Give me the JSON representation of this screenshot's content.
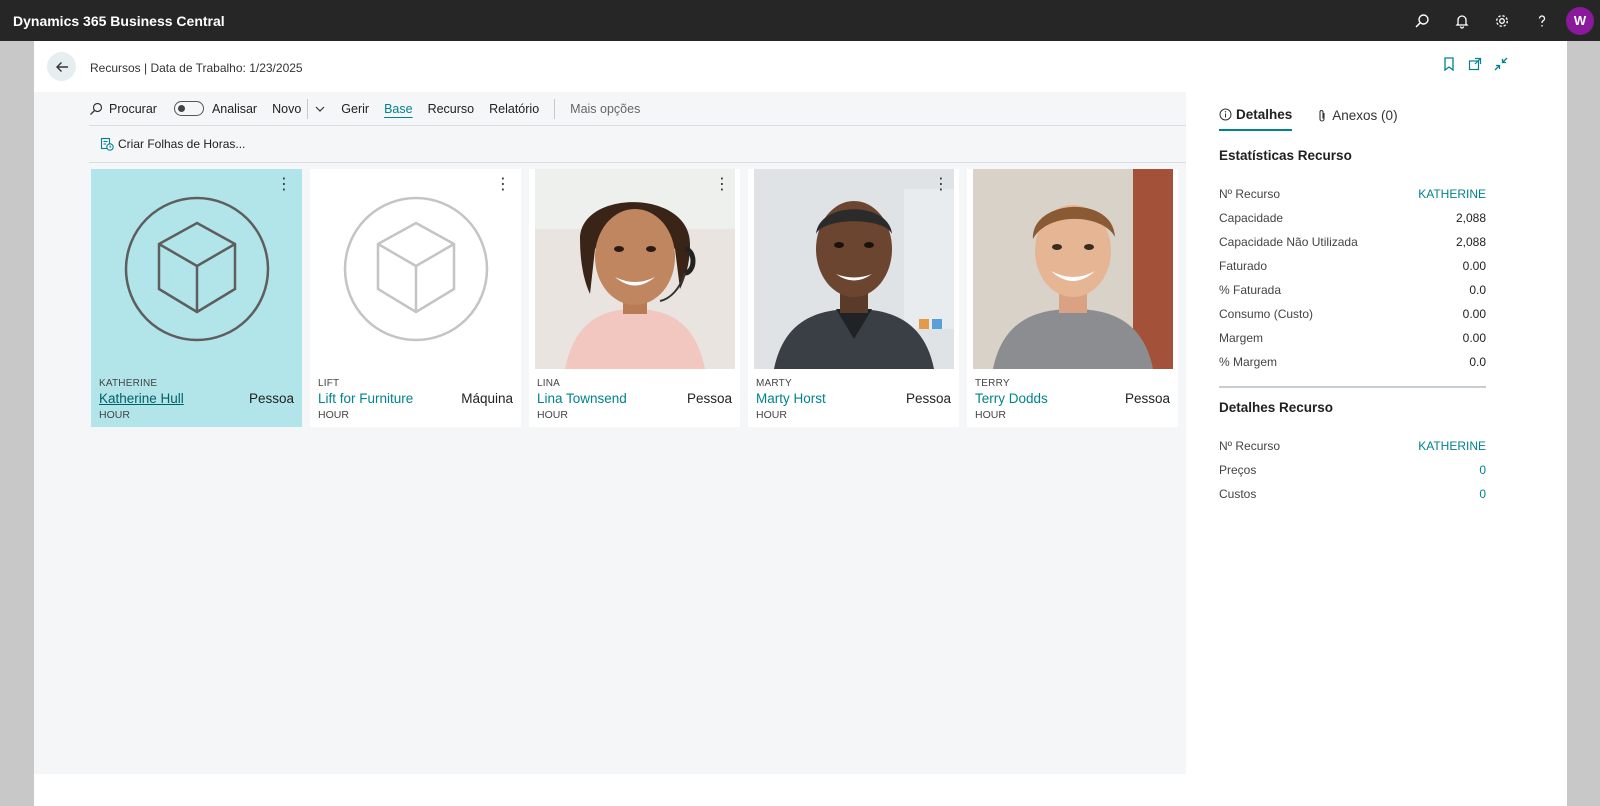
{
  "topbar": {
    "app_title": "Dynamics 365 Business Central",
    "avatar_initial": "W"
  },
  "page": {
    "breadcrumb": "Recursos | Data de Trabalho: 1/23/2025"
  },
  "actions": {
    "search": "Procurar",
    "analyze": "Analisar",
    "new": "Novo",
    "manage": "Gerir",
    "base": "Base",
    "resource": "Recurso",
    "report": "Relatório",
    "more": "Mais opções"
  },
  "promoted": {
    "create_timesheets": "Criar Folhas de Horas..."
  },
  "tiles": [
    {
      "code": "KATHERINE",
      "name": "Katherine Hull",
      "type": "Pessoa",
      "uom": "HOUR"
    },
    {
      "code": "LIFT",
      "name": "Lift for Furniture",
      "type": "Máquina",
      "uom": "HOUR"
    },
    {
      "code": "LINA",
      "name": "Lina Townsend",
      "type": "Pessoa",
      "uom": "HOUR"
    },
    {
      "code": "MARTY",
      "name": "Marty Horst",
      "type": "Pessoa",
      "uom": "HOUR"
    },
    {
      "code": "TERRY",
      "name": "Terry Dodds",
      "type": "Pessoa",
      "uom": "HOUR"
    }
  ],
  "factbox": {
    "tab_details": "Detalhes",
    "tab_attachments": "Anexos (0)",
    "stats_title": "Estatísticas Recurso",
    "stats": [
      {
        "label": "Nº Recurso",
        "value": "KATHERINE"
      },
      {
        "label": "Capacidade",
        "value": "2,088"
      },
      {
        "label": "Capacidade Não Utilizada",
        "value": "2,088"
      },
      {
        "label": "Faturado",
        "value": "0.00"
      },
      {
        "label": "% Faturada",
        "value": "0.0"
      },
      {
        "label": "Consumo (Custo)",
        "value": "0.00"
      },
      {
        "label": "Margem",
        "value": "0.00"
      },
      {
        "label": "% Margem",
        "value": "0.0"
      }
    ],
    "details_title": "Detalhes Recurso",
    "details": [
      {
        "label": "Nº Recurso",
        "value": "KATHERINE"
      },
      {
        "label": "Preços",
        "value": "0"
      },
      {
        "label": "Custos",
        "value": "0"
      }
    ]
  },
  "colors": {
    "accent": "#00838a",
    "selected_tile": "#b2e5ea",
    "topbar": "#262626",
    "avatar": "#8a1a9b"
  }
}
